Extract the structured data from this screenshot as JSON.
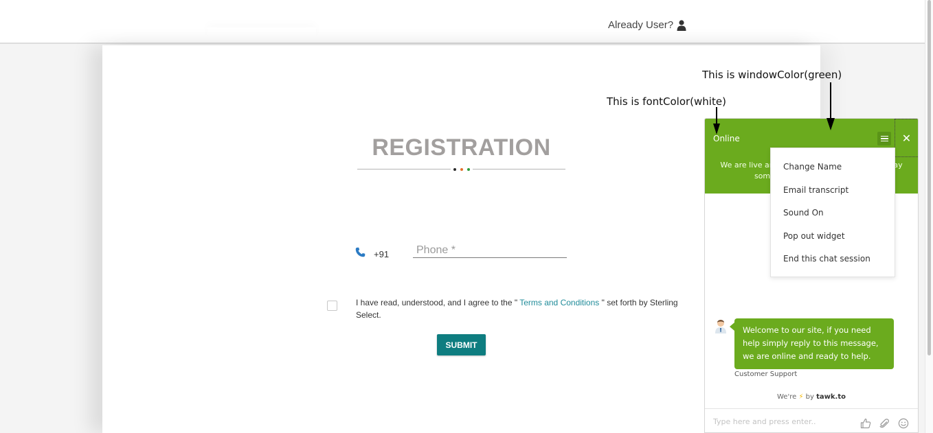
{
  "header": {
    "already_user": "Already User?",
    "user_icon": "user-icon"
  },
  "registration": {
    "title": "REGISTRATION",
    "dot_colors": [
      "#2b2b2b",
      "#e36f2b",
      "#2e9c3a"
    ],
    "country_code": "+91",
    "phone_placeholder": "Phone *",
    "phone_icon": "phone-icon",
    "terms_prefix": "I have read, understood, and I agree to the \"",
    "terms_link": " Terms and Conditions ",
    "terms_suffix": "\" set forth by Sterling Select.",
    "submit_label": "SUBMIT",
    "accent_color": "#0e7d80"
  },
  "annotations": {
    "window_color": "This is windowColor(green)",
    "font_color": "This is fontColor(white)"
  },
  "chat": {
    "status": "Online",
    "tagline": "We are live and ready to chat with you now. Say something to start a live chat.",
    "window_color": "#6bab1e",
    "menu_items": [
      "Change Name",
      "Email transcript",
      "Sound On",
      "Pop out widget",
      "End this chat session"
    ],
    "message": "Welcome to our site, if you need help simply reply to this message, we are online and ready to help.",
    "agent_name": "Customer Support",
    "branding_prefix": "We're",
    "branding_by": "by",
    "branding_brand": "tawk.to",
    "input_placeholder": "Type here and press enter..",
    "icons": [
      "menu-icon",
      "close-icon",
      "thumbs-up-icon",
      "paperclip-icon",
      "smiley-icon"
    ]
  }
}
